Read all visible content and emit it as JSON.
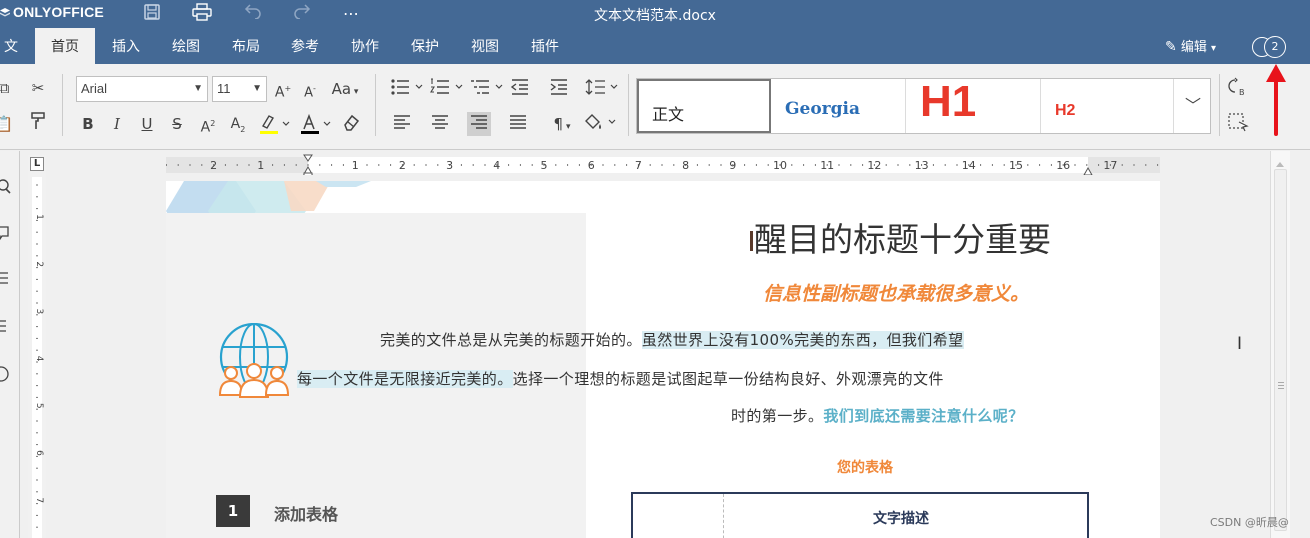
{
  "app": {
    "brand": "ONLYOFFICE",
    "document_title": "文本文档范本.docx"
  },
  "menu_tabs": [
    {
      "label": "文件"
    },
    {
      "label": "首页",
      "active": true
    },
    {
      "label": "插入"
    },
    {
      "label": "绘图"
    },
    {
      "label": "布局"
    },
    {
      "label": "参考"
    },
    {
      "label": "协作"
    },
    {
      "label": "保护"
    },
    {
      "label": "视图"
    },
    {
      "label": "插件"
    }
  ],
  "header_right": {
    "edit_mode_label": "编辑",
    "user_count": "2"
  },
  "toolbar": {
    "font_name": "Arial",
    "font_size": "11",
    "case_button": "Aa"
  },
  "styles_gallery": [
    {
      "label": "正文"
    },
    {
      "label": "Georgia"
    },
    {
      "label": "H1"
    },
    {
      "label": "H2"
    }
  ],
  "ruler": {
    "ticks": [
      "2",
      "1",
      "1",
      "2",
      "3",
      "4",
      "5",
      "6",
      "7",
      "8",
      "9",
      "10",
      "11",
      "12",
      "13",
      "14",
      "15",
      "16",
      "17"
    ]
  },
  "document": {
    "title": "醒目的标题十分重要",
    "subtitle": "信息性副标题也承载很多意义。",
    "para_line1_plain": "完美的文件总是从完美的标题开始的。",
    "para_line1_hl": "虽然世界上没有100%完美的东西，但我们希望",
    "para_line2_hl": "每一个文件是无限接近完美的。",
    "para_line2_plain": "选择一个理想的标题是试图起草一份结构良好、外观漂亮的文件",
    "para_line3_plain": "时的第一步。",
    "para_line3_accent": "我们到底还需要注意什么呢？",
    "table_title": "您的表格",
    "table_header": "文字描述",
    "section_number": "1",
    "section_label": "添加表格"
  },
  "watermark": "CSDN @昕晨@",
  "colors": {
    "brand_blue": "#446995",
    "accent_orange": "#f0883a",
    "accent_teal": "#5bb0c8",
    "h1_red": "#e8392b",
    "arrow_red": "#e8131b"
  }
}
